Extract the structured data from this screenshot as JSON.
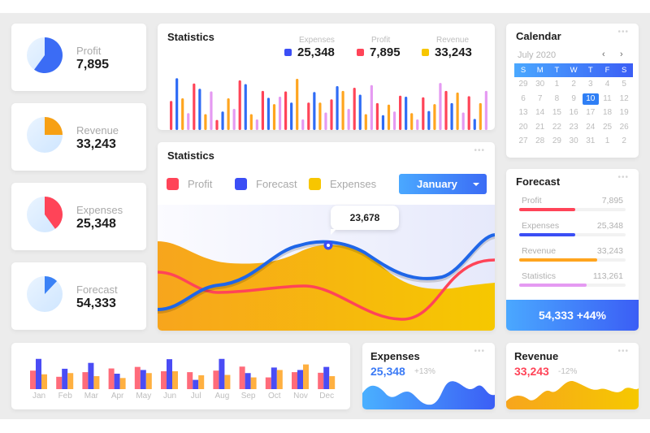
{
  "kpis": [
    {
      "label": "Profit",
      "value": "7,895",
      "color": "#3b6cf5",
      "share": 0.6
    },
    {
      "label": "Revenue",
      "value": "33,243",
      "color": "#f7a014",
      "share": 0.25
    },
    {
      "label": "Expenses",
      "value": "25,348",
      "color": "#ff4458",
      "share": 0.4
    },
    {
      "label": "Forecast",
      "value": "54,333",
      "color": "#3b82f6",
      "share": 0.12
    }
  ],
  "stats_top": {
    "title": "Statistics",
    "legend": [
      {
        "name": "Expenses",
        "value": "25,348",
        "color": "#3b4ef5"
      },
      {
        "name": "Profit",
        "value": "7,895",
        "color": "#ff4458"
      },
      {
        "name": "Revenue",
        "value": "33,243",
        "color": "#f7c600"
      }
    ],
    "colors": {
      "red": "#ff4458",
      "blue": "#2f6cf5",
      "orange": "#ffa51f",
      "pink": "#e59af2"
    },
    "bars": [
      [
        "red",
        0.55
      ],
      [
        "blue",
        0.98
      ],
      [
        "orange",
        0.6
      ],
      [
        "pink",
        0.32
      ],
      [
        "red",
        0.88
      ],
      [
        "blue",
        0.78
      ],
      [
        "orange",
        0.3
      ],
      [
        "pink",
        0.73
      ],
      [
        "red",
        0.19
      ],
      [
        "blue",
        0.35
      ],
      [
        "orange",
        0.6
      ],
      [
        "pink",
        0.4
      ],
      [
        "red",
        0.94
      ],
      [
        "blue",
        0.87
      ],
      [
        "orange",
        0.3
      ],
      [
        "pink",
        0.2
      ],
      [
        "red",
        0.74
      ],
      [
        "blue",
        0.61
      ],
      [
        "orange",
        0.49
      ],
      [
        "pink",
        0.63
      ],
      [
        "red",
        0.73
      ],
      [
        "blue",
        0.52
      ],
      [
        "orange",
        0.97
      ],
      [
        "pink",
        0.2
      ],
      [
        "red",
        0.52
      ],
      [
        "blue",
        0.72
      ],
      [
        "orange",
        0.52
      ],
      [
        "pink",
        0.33
      ],
      [
        "red",
        0.58
      ],
      [
        "blue",
        0.83
      ],
      [
        "orange",
        0.74
      ],
      [
        "pink",
        0.4
      ],
      [
        "red",
        0.8
      ],
      [
        "blue",
        0.67
      ],
      [
        "orange",
        0.3
      ],
      [
        "pink",
        0.85
      ],
      [
        "red",
        0.51
      ],
      [
        "blue",
        0.28
      ],
      [
        "orange",
        0.48
      ],
      [
        "pink",
        0.35
      ],
      [
        "red",
        0.65
      ],
      [
        "blue",
        0.63
      ],
      [
        "orange",
        0.32
      ],
      [
        "pink",
        0.2
      ],
      [
        "red",
        0.62
      ],
      [
        "blue",
        0.36
      ],
      [
        "orange",
        0.49
      ],
      [
        "pink",
        0.89
      ],
      [
        "red",
        0.74
      ],
      [
        "blue",
        0.51
      ],
      [
        "orange",
        0.71
      ],
      [
        "pink",
        0.33
      ],
      [
        "red",
        0.64
      ],
      [
        "blue",
        0.21
      ],
      [
        "orange",
        0.51
      ],
      [
        "pink",
        0.74
      ]
    ]
  },
  "stats_main": {
    "title": "Statistics",
    "legend": [
      {
        "name": "Profit",
        "color": "#ff4458"
      },
      {
        "name": "Forecast",
        "color": "#3b4ef5"
      },
      {
        "name": "Expenses",
        "color": "#f7c600"
      }
    ],
    "month_select": "January",
    "tooltip_value": "23,678"
  },
  "calendar": {
    "title": "Calendar",
    "month": "July 2020",
    "prev": "‹",
    "next": "›",
    "weekdays": [
      "S",
      "M",
      "T",
      "W",
      "T",
      "F",
      "S"
    ],
    "weeks": [
      [
        "29",
        "30",
        "1",
        "2",
        "3",
        "4",
        "5"
      ],
      [
        "6",
        "7",
        "8",
        "9",
        "10",
        "11",
        "12"
      ],
      [
        "13",
        "14",
        "15",
        "16",
        "17",
        "18",
        "19"
      ],
      [
        "20",
        "21",
        "22",
        "23",
        "24",
        "25",
        "26"
      ],
      [
        "27",
        "28",
        "29",
        "30",
        "31",
        "1",
        "2"
      ]
    ],
    "selected": "10"
  },
  "forecast": {
    "title": "Forecast",
    "rows": [
      {
        "name": "Profit",
        "value": "7,895",
        "fraction": 0.53,
        "color": "#ff4458"
      },
      {
        "name": "Expenses",
        "value": "25,348",
        "fraction": 0.53,
        "color": "#3b4ef5"
      },
      {
        "name": "Revenue",
        "value": "33,243",
        "fraction": 0.73,
        "color": "#ffa51f"
      },
      {
        "name": "Statistics",
        "value": "113,261",
        "fraction": 0.63,
        "color": "#e59af2"
      }
    ],
    "total": "54,333 +44%"
  },
  "monthly": {
    "months": [
      "Jan",
      "Feb",
      "Mar",
      "Apr",
      "May",
      "Jun",
      "Jul",
      "Aug",
      "Sep",
      "Oct",
      "Nov",
      "Dec"
    ],
    "series": [
      {
        "name": "red",
        "color": "#ff6b7a",
        "values": [
          0.6,
          0.4,
          0.55,
          0.67,
          0.72,
          0.58,
          0.55,
          0.6,
          0.73,
          0.38,
          0.55,
          0.53
        ]
      },
      {
        "name": "blue",
        "color": "#4a4cf5",
        "values": [
          0.98,
          0.66,
          0.85,
          0.5,
          0.62,
          0.97,
          0.3,
          0.98,
          0.52,
          0.7,
          0.62,
          0.72
        ]
      },
      {
        "name": "orange",
        "color": "#ffb040",
        "values": [
          0.48,
          0.52,
          0.42,
          0.36,
          0.52,
          0.58,
          0.45,
          0.46,
          0.38,
          0.62,
          0.8,
          0.42
        ]
      }
    ]
  },
  "small_expenses": {
    "title": "Expenses",
    "value": "25,348",
    "change": "+13%",
    "color": "#3b82f6"
  },
  "small_revenue": {
    "title": "Revenue",
    "value": "33,243",
    "change": "-12%",
    "color": "#ff4458"
  }
}
